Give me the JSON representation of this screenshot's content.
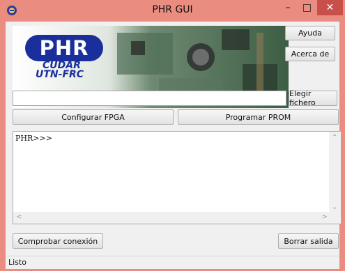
{
  "window": {
    "title": "PHR GUI",
    "minimize_glyph": "–",
    "maximize_glyph": "□",
    "close_glyph": "✕"
  },
  "banner": {
    "logo_text": "PHR",
    "line1": "CUDAR",
    "line2": "UTN-FRC"
  },
  "buttons": {
    "help": "Ayuda",
    "about": "Acerca de",
    "choose_file": "Elegir fichero",
    "configure_fpga": "Configurar FPGA",
    "program_prom": "Programar PROM",
    "check_connection": "Comprobar conexión",
    "clear_output": "Borrar salida"
  },
  "file_input": {
    "value": ""
  },
  "output": {
    "prompt": "PHR>>>"
  },
  "status": {
    "text": "Listo"
  },
  "icons": {
    "app": "phr-app-icon",
    "scroll_up": "chevron-up-icon",
    "scroll_down": "chevron-down-icon",
    "scroll_left": "chevron-left-icon",
    "scroll_right": "chevron-right-icon"
  },
  "colors": {
    "titlebar": "#ea8d80",
    "close_button": "#c7504a",
    "logo_blue": "#1b2f9c",
    "board_green": "#2f5a3a"
  }
}
